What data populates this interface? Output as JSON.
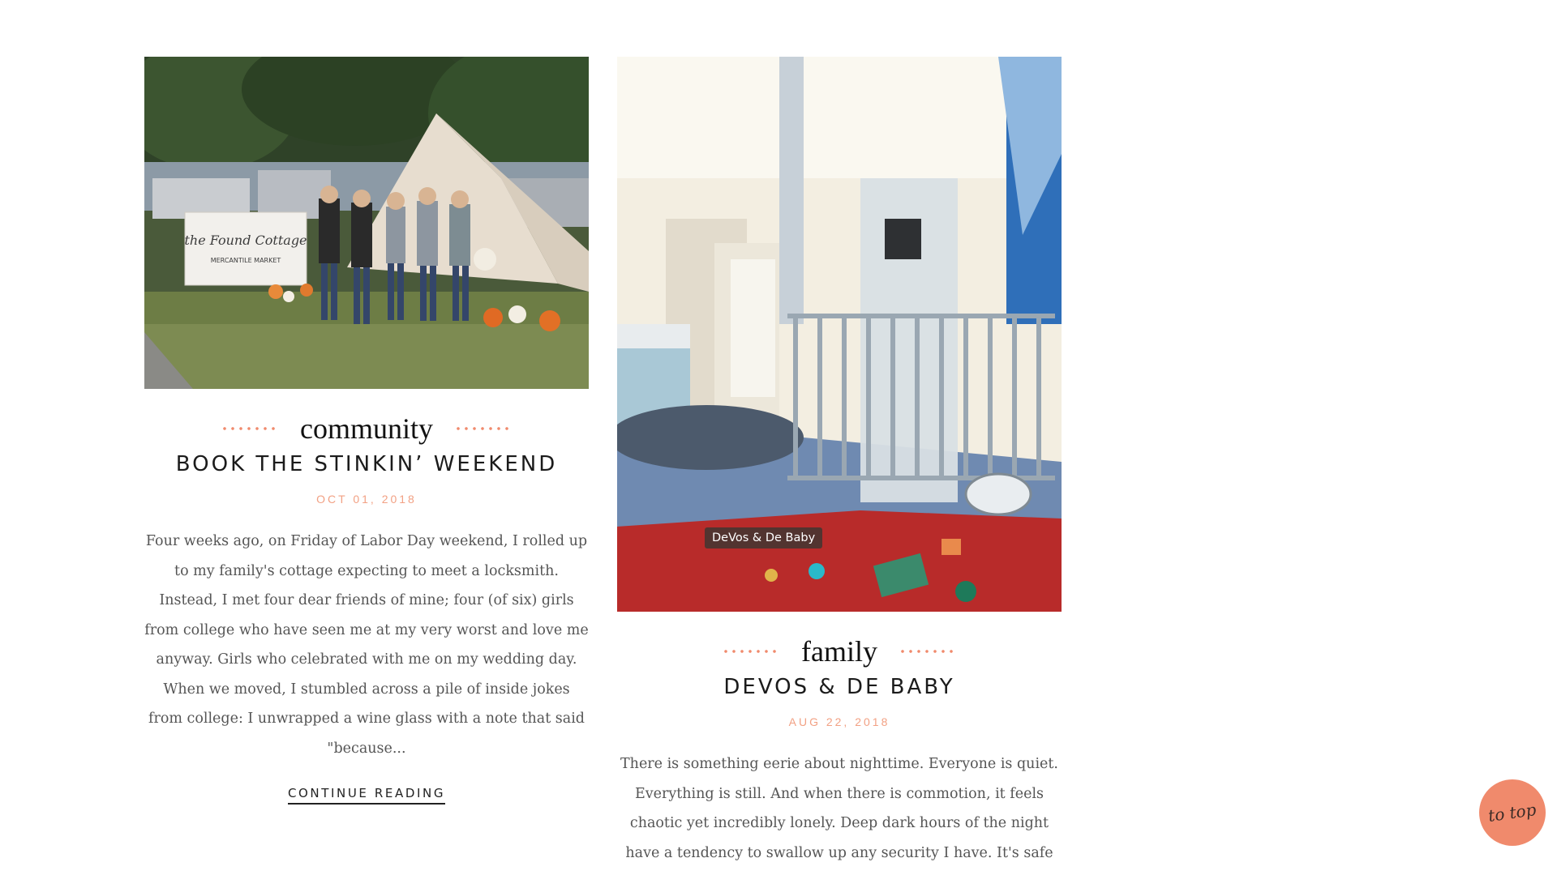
{
  "posts": [
    {
      "category": "community",
      "title": "BOOK THE STINKIN’ WEEKEND",
      "date": "OCT 01, 2018",
      "excerpt": "Four weeks ago, on Friday of Labor Day weekend, I rolled up to my family's cottage expecting to meet a locksmith. Instead, I met four dear friends of mine; four (of six) girls from college who have seen me at my very worst and love me anyway. Girls who celebrated with me on my wedding day. When we moved, I stumbled across a pile of inside jokes from college: I unwrapped a wine glass with a note that said \"because...",
      "continue_label": "CONTINUE READING",
      "image": {
        "sign_line1": "the Found Cottage",
        "sign_line2": "MERCANTILE MARKET"
      }
    },
    {
      "category": "family",
      "title": "DEVOS & DE BABY",
      "date": "AUG 22, 2018",
      "excerpt": "There is something eerie about nighttime. Everyone is quiet. Everything is still. And when there is commotion, it feels chaotic yet incredibly lonely. Deep dark hours of the night have a tendency to swallow up any security I have. It's safe to",
      "image_tooltip": "DeVos & De Baby"
    }
  ],
  "to_top_label": "to top",
  "colors": {
    "accent": "#f08a6c",
    "date": "#f2a184",
    "text": "#555555",
    "heading": "#1b1b1b"
  }
}
